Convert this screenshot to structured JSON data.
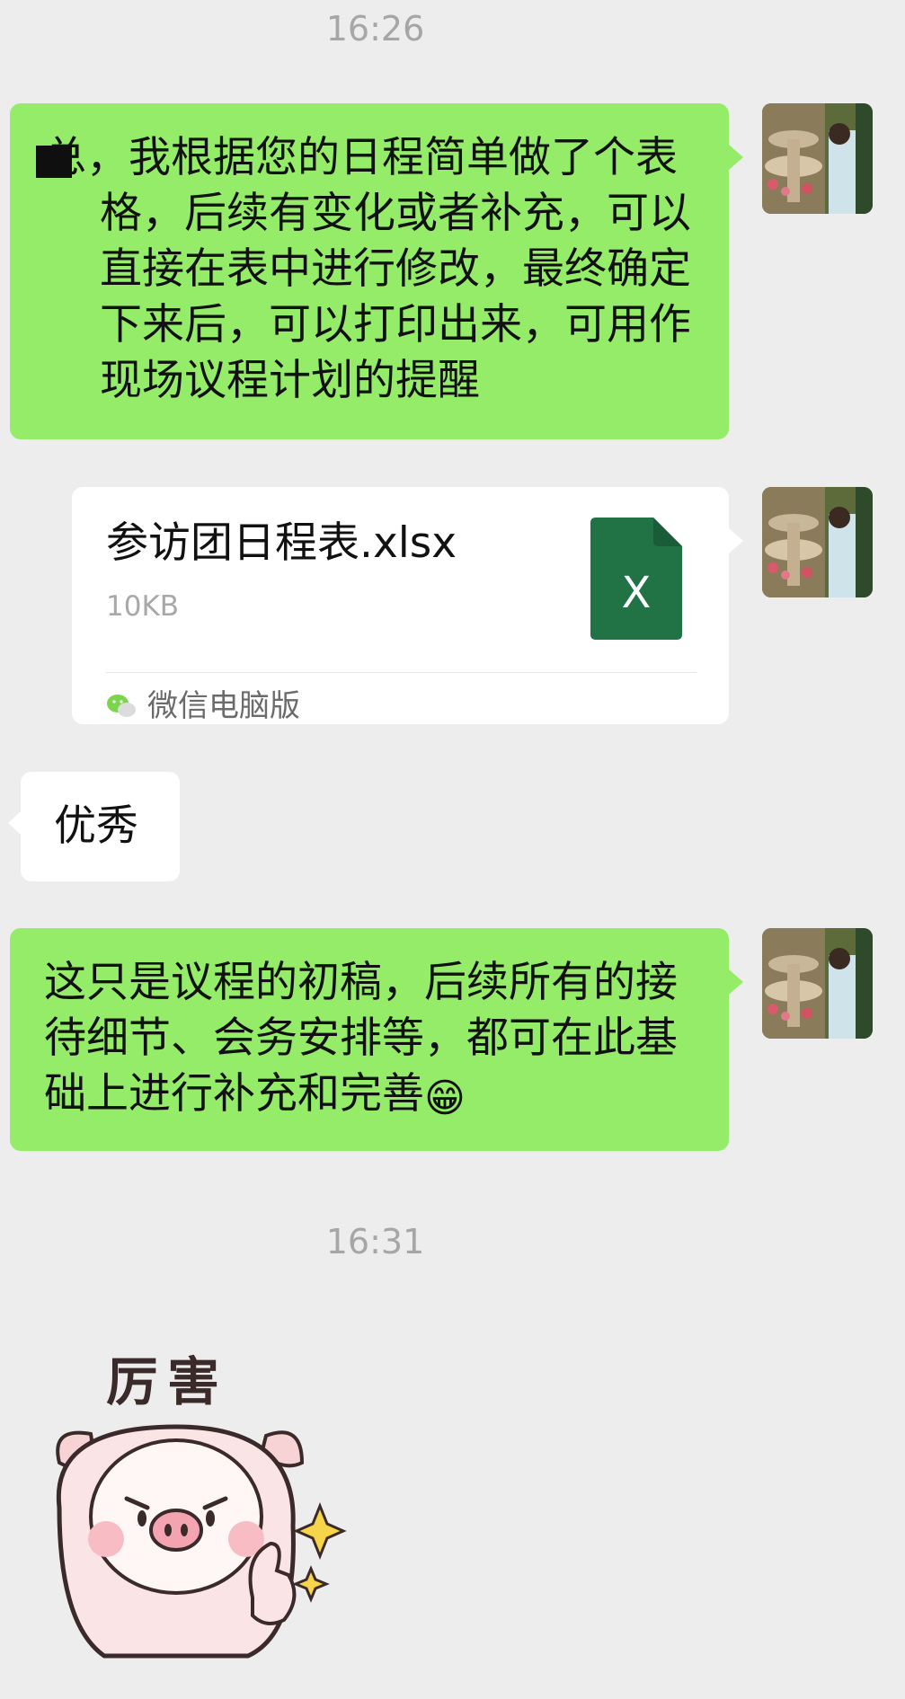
{
  "chat": {
    "time_1": "16:26",
    "msg_1": "总，我根据您的日程简单做了个表格，后续有变化或者补充，可以直接在表中进行修改，最终确定下来后，可以打印出来，可用作现场议程计划的提醒",
    "file": {
      "name": "参访团日程表.xlsx",
      "size": "10KB",
      "source": "微信电脑版",
      "icon_letter": "X"
    },
    "msg_reply": "优秀",
    "msg_3": "这只是议程的初稿，后续所有的接待细节、会务安排等，都可在此基础上进行补充和完善",
    "msg_3_emoji": "😁",
    "time_2": "16:31",
    "sticker_text": "厉害"
  },
  "colors": {
    "background": "#ededed",
    "bubble_sent": "#95ec69",
    "bubble_received": "#ffffff",
    "excel_green": "#217346",
    "timestamp": "#a6a6a6"
  },
  "icons": {
    "avatar": "avatar-photo-icon",
    "file": "excel-file-icon",
    "source": "wechat-icon",
    "sticker": "pig-thumbs-up-sticker"
  }
}
